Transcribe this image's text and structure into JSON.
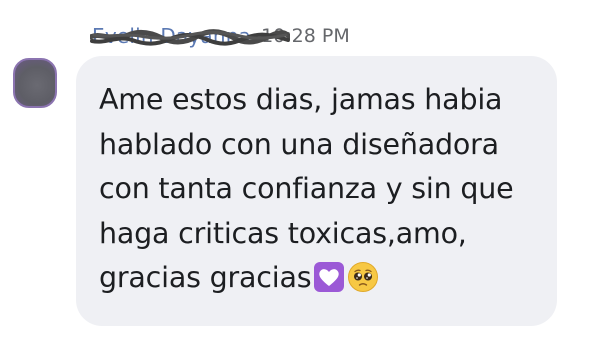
{
  "header": {
    "sender_name": "Evelin Dayanna",
    "time": "10:28 PM"
  },
  "avatar": {
    "color": "#5e5e66",
    "border_color": "#8b74b0"
  },
  "message": {
    "lines": [
      "Ame estos dias, jamas habia",
      "hablado con una diseñadora",
      "con tanta confianza y sin que",
      "haga criticas toxicas,amo,",
      "gracias gracias"
    ],
    "emojis": [
      "purple-heart-icon",
      "pleading-face-icon"
    ],
    "bubble_color": "#eff0f4",
    "text_color": "#1c1e21"
  }
}
